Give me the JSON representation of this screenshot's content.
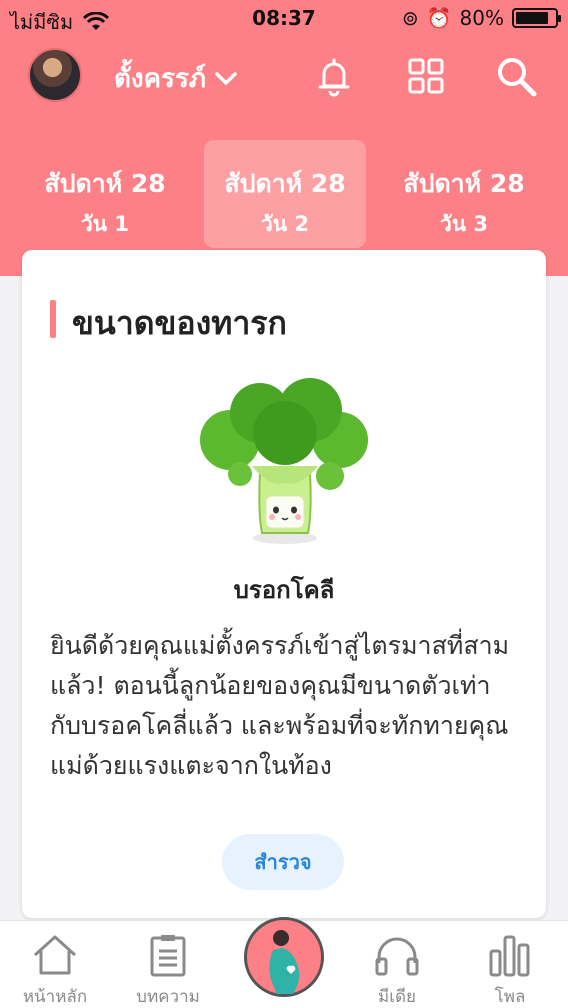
{
  "status_bar": {
    "carrier": "ไม่มีซิม",
    "time": "08:37",
    "battery": "80%",
    "battery_level": 0.8
  },
  "top_bar": {
    "profile_name": "ตั้งครรภ์",
    "icons": [
      "avatar",
      "chevron-down-icon",
      "bell-icon",
      "grid-icon",
      "search-icon"
    ]
  },
  "week_selector": [
    {
      "week": "สัปดาห์ 28",
      "day": "วัน 1",
      "active": false
    },
    {
      "week": "สัปดาห์ 28",
      "day": "วัน 2",
      "active": true
    },
    {
      "week": "สัปดาห์ 28",
      "day": "วัน 3",
      "active": false
    }
  ],
  "baby_size_card": {
    "title": "ขนาดของทารก",
    "fruit_name": "บรอกโคลี",
    "description": "ยินดีด้วยคุณแม่ตั้งครรภ์เข้าสู่ไตรมาสที่สามแล้ว! ตอนนี้ลูกน้อยของคุณมีขนาดตัวเท่ากับบรอคโคลี่แล้ว และพร้อมที่จะทักทายคุณแม่ด้วยแรงแตะจากในท้อง",
    "explore_label": "สำรวจ"
  },
  "tab_bar": {
    "items": [
      {
        "label": "หน้าหลัก",
        "icon": "home-icon"
      },
      {
        "label": "บทความ",
        "icon": "clipboard-icon"
      },
      {
        "label": "",
        "icon": "pregnancy-center-icon"
      },
      {
        "label": "มีเดีย",
        "icon": "headphones-icon"
      },
      {
        "label": "โพล",
        "icon": "bar-chart-icon"
      }
    ]
  },
  "colors": {
    "header": "#fd8086",
    "explore_bg": "#e6f3ff",
    "explore_text": "#2b86d8"
  }
}
